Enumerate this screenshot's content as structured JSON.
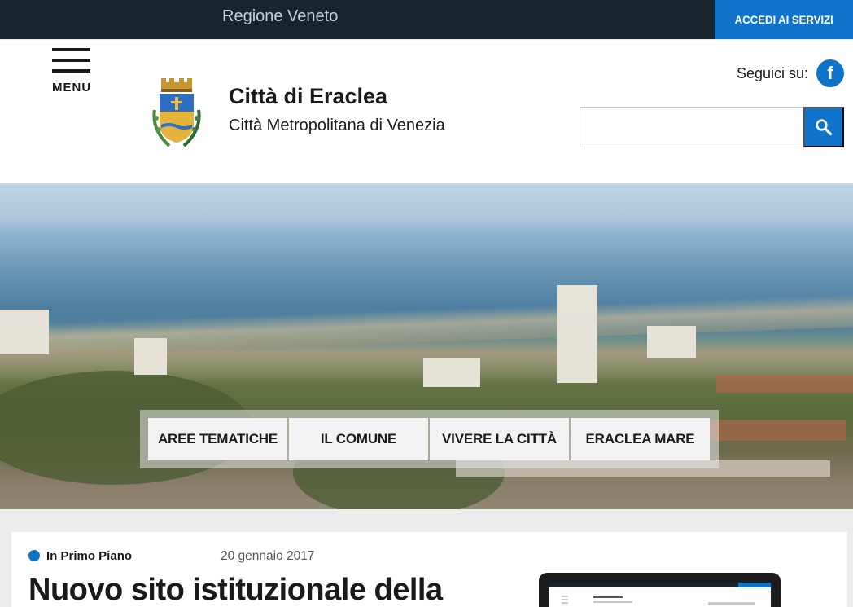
{
  "topbar": {
    "region": "Regione Veneto",
    "access_label": "ACCEDI AI SERVIZI"
  },
  "header": {
    "menu_label": "MENU",
    "title": "Città di Eraclea",
    "subtitle": "Città Metropolitana di Venezia",
    "follow_label": "Seguici su:",
    "facebook_icon": "facebook-icon",
    "search_placeholder": "",
    "search_icon": "search-icon"
  },
  "nav": {
    "items": [
      {
        "label": "AREE TEMATICHE"
      },
      {
        "label": "IL COMUNE"
      },
      {
        "label": "VIVERE LA CITTÀ"
      },
      {
        "label": "ERACLEA MARE"
      }
    ]
  },
  "news": {
    "category": "In Primo Piano",
    "date": "20 gennaio 2017",
    "headline": "Nuovo sito istituzionale della"
  },
  "colors": {
    "accent": "#0f73c9",
    "topbar": "#18242e",
    "background": "#ececec"
  }
}
